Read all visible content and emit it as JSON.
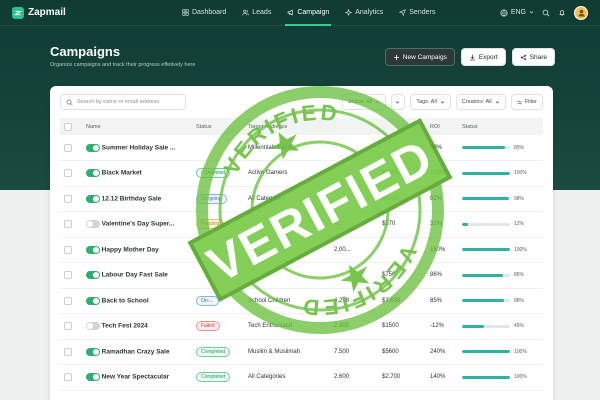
{
  "app": {
    "name": "Zapmail"
  },
  "nav": [
    {
      "label": "Dashboard",
      "icon": "grid-icon"
    },
    {
      "label": "Leads",
      "icon": "users-icon"
    },
    {
      "label": "Campaign",
      "icon": "megaphone-icon",
      "active": true
    },
    {
      "label": "Analytics",
      "icon": "sparkle-icon"
    },
    {
      "label": "Senders",
      "icon": "send-icon"
    }
  ],
  "nav_right": {
    "language": "ENG"
  },
  "header": {
    "title": "Campaigns",
    "subtitle": "Organize campaigns and track their progress effetively here",
    "new_button": "New Campaigs",
    "export_button": "Export",
    "share_button": "Share"
  },
  "toolbar": {
    "search_placeholder": "Search by name or email address",
    "filter_status": "Status: All",
    "filter_tags": "Tags: All",
    "filter_creators": "Creators: All",
    "filter_button": "Filter"
  },
  "table": {
    "columns": [
      "Name",
      "Status",
      "Target Audience",
      "",
      "",
      "ROI",
      "Status"
    ],
    "rows": [
      {
        "name": "Summer Holiday Sale ...",
        "on": true,
        "status": "",
        "status_class": "",
        "audience": "Millennials Fashi...",
        "num": "",
        "revenue": "",
        "roi": "89%",
        "progress": 0.89,
        "pct": "89%"
      },
      {
        "name": "Black Market",
        "on": true,
        "status": "Completed",
        "status_class": "b-completed",
        "audience": "Active Gamers",
        "num": "",
        "revenue": "$4200",
        "roi": "120%",
        "progress": 1.0,
        "pct": "100%"
      },
      {
        "name": "12.12 Birthday Sale",
        "on": true,
        "status": "On-going",
        "status_class": "b-ongoing",
        "audience": "All Categories",
        "num": "",
        "revenue": "$6100",
        "roi": "92%",
        "progress": 0.98,
        "pct": "98%"
      },
      {
        "name": "Valentine's Day Super...",
        "on": false,
        "status": "Pending",
        "status_class": "b-pending",
        "audience": "",
        "num": "4,2...",
        "revenue": "$570",
        "roi": "32%",
        "progress": 0.12,
        "pct": "12%"
      },
      {
        "name": "Happy Mother Day",
        "on": true,
        "status": "",
        "status_class": "",
        "audience": "",
        "num": "2,00...",
        "revenue": "",
        "roi": "150%",
        "progress": 1.0,
        "pct": "100%"
      },
      {
        "name": "Labour Day Fast Sale",
        "on": true,
        "status": "",
        "status_class": "",
        "audience": "",
        "num": "",
        "revenue": "$750",
        "roi": "86%",
        "progress": 0.86,
        "pct": "86%"
      },
      {
        "name": "Back to School",
        "on": true,
        "status": "On-...",
        "status_class": "b-ongoing",
        "audience": "School Children",
        "num": "4,278",
        "revenue": "$3,638",
        "roi": "85%",
        "progress": 0.88,
        "pct": "88%"
      },
      {
        "name": "Tech Fest 2024",
        "on": false,
        "status": "Failed",
        "status_class": "b-failed",
        "audience": "Tech Enthusiasd",
        "num": "2.300",
        "revenue": "$1500",
        "roi": "-12%",
        "progress": 0.45,
        "pct": "45%"
      },
      {
        "name": "Ramadhan Crazy Sale",
        "on": true,
        "status": "Completed",
        "status_class": "b-completed",
        "audience": "Muslim & Muslimah",
        "num": "7.500",
        "revenue": "$5600",
        "roi": "240%",
        "progress": 1.0,
        "pct": "100%"
      },
      {
        "name": "New Year Spectacular",
        "on": true,
        "status": "Completed",
        "status_class": "b-completed",
        "audience": "All Categories",
        "num": "2.600",
        "revenue": "$2.700",
        "roi": "140%",
        "progress": 1.0,
        "pct": "100%"
      }
    ]
  },
  "stamp": {
    "main_text": "VERIFIED",
    "arc_text_top": "VERIFIED",
    "arc_text_bottom": "VERIFIED",
    "color": "#6cbf3f"
  }
}
